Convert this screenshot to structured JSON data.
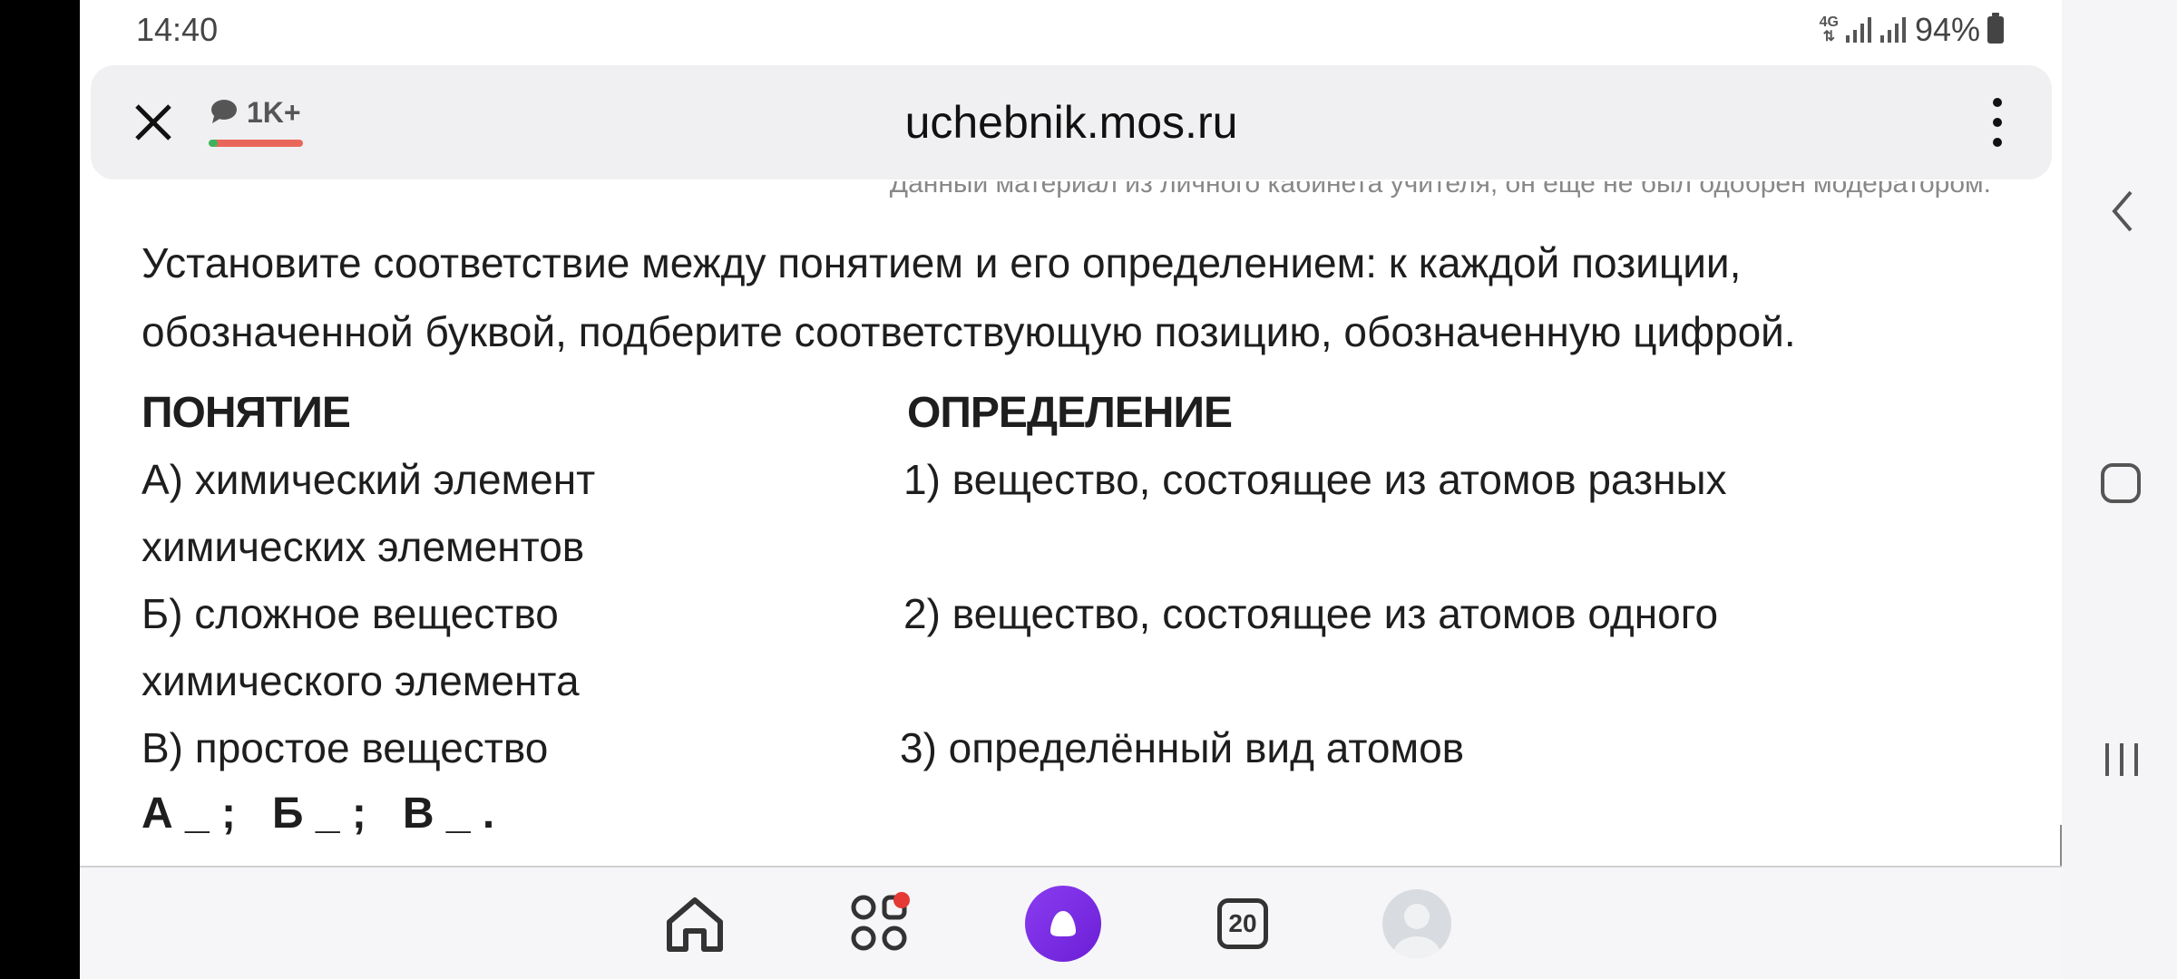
{
  "status_bar": {
    "time": "14:40",
    "network": "4G",
    "battery": "94%"
  },
  "browser": {
    "url": "uchebnik.mos.ru",
    "comments_count": "1K+"
  },
  "content": {
    "notice": "Данный материал из личного кабинета учителя, он еще не был одобрен модератором.",
    "task": "Установите соответствие между понятием и его определением: к каждой позиции, обозначенной буквой, подберите соответствующую позицию, обозначенную цифрой.",
    "left_header": "ПОНЯТИЕ",
    "right_header": "ОПРЕДЕЛЕНИЕ",
    "rows": [
      {
        "left": "А) химический элемент",
        "right": "1) вещество, состоящее из атомов разных"
      },
      {
        "left": "химических элементов",
        "right": ""
      },
      {
        "left": "Б) сложное вещество",
        "right": "2) вещество, состоящее из атомов одного"
      },
      {
        "left": "химического элемента",
        "right": ""
      },
      {
        "left": "В) простое вещество",
        "right": "3) определённый вид атомов"
      }
    ],
    "answer": "А _ ;   Б _ ;   В _ ."
  },
  "toolbar": {
    "tabs_count": "20"
  }
}
